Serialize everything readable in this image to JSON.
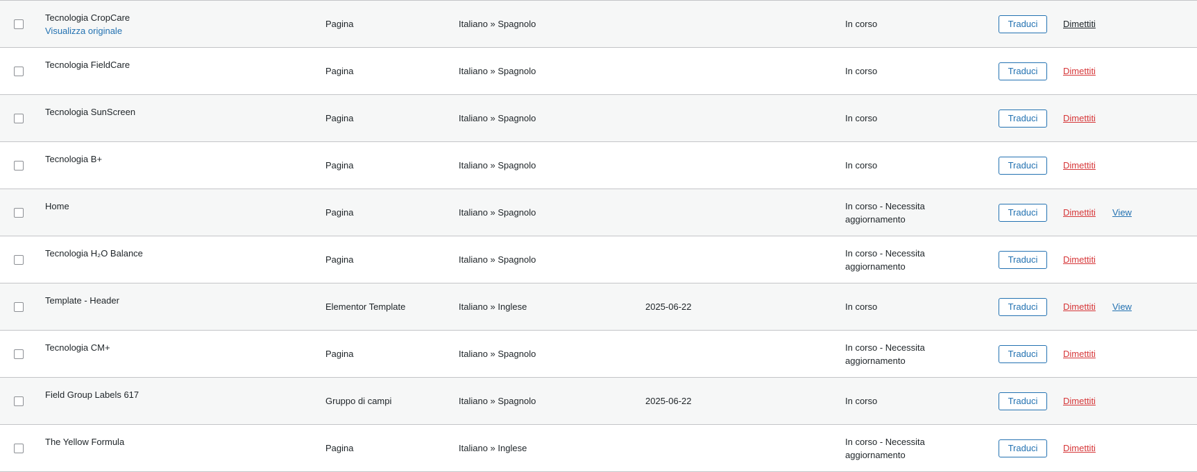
{
  "colors": {
    "link_blue": "#2271b1",
    "danger_red": "#d63638",
    "text": "#1d2327",
    "row_alt": "#f6f7f7",
    "border": "#c3c4c7"
  },
  "rows": [
    {
      "title": "Tecnologia CropCare",
      "subtitle": "Visualizza originale",
      "type": "Pagina",
      "languages": "Italiano » Spagnolo",
      "date": "",
      "status": "In corso",
      "translate": "Traduci",
      "resign": "Dimettiti",
      "resign_style": "dark",
      "view": ""
    },
    {
      "title": "Tecnologia FieldCare",
      "subtitle": "",
      "type": "Pagina",
      "languages": "Italiano » Spagnolo",
      "date": "",
      "status": "In corso",
      "translate": "Traduci",
      "resign": "Dimettiti",
      "resign_style": "red",
      "view": ""
    },
    {
      "title": "Tecnologia SunScreen",
      "subtitle": "",
      "type": "Pagina",
      "languages": "Italiano » Spagnolo",
      "date": "",
      "status": "In corso",
      "translate": "Traduci",
      "resign": "Dimettiti",
      "resign_style": "red",
      "view": ""
    },
    {
      "title": "Tecnologia B+",
      "subtitle": "",
      "type": "Pagina",
      "languages": "Italiano » Spagnolo",
      "date": "",
      "status": "In corso",
      "translate": "Traduci",
      "resign": "Dimettiti",
      "resign_style": "red",
      "view": ""
    },
    {
      "title": "Home",
      "subtitle": "",
      "type": "Pagina",
      "languages": "Italiano » Spagnolo",
      "date": "",
      "status": "In corso - Necessita aggiornamento",
      "translate": "Traduci",
      "resign": "Dimettiti",
      "resign_style": "red",
      "view": "View"
    },
    {
      "title": "Tecnologia H₂O Balance",
      "subtitle": "",
      "type": "Pagina",
      "languages": "Italiano » Spagnolo",
      "date": "",
      "status": "In corso - Necessita aggiornamento",
      "translate": "Traduci",
      "resign": "Dimettiti",
      "resign_style": "red",
      "view": ""
    },
    {
      "title": "Template - Header",
      "subtitle": "",
      "type": "Elementor Template",
      "languages": "Italiano » Inglese",
      "date": "2025-06-22",
      "status": "In corso",
      "translate": "Traduci",
      "resign": "Dimettiti",
      "resign_style": "red",
      "view": "View"
    },
    {
      "title": "Tecnologia CM+",
      "subtitle": "",
      "type": "Pagina",
      "languages": "Italiano » Spagnolo",
      "date": "",
      "status": "In corso - Necessita aggiornamento",
      "translate": "Traduci",
      "resign": "Dimettiti",
      "resign_style": "red",
      "view": ""
    },
    {
      "title": "Field Group Labels 617",
      "subtitle": "",
      "type": "Gruppo di campi",
      "languages": "Italiano » Spagnolo",
      "date": "2025-06-22",
      "status": "In corso",
      "translate": "Traduci",
      "resign": "Dimettiti",
      "resign_style": "red",
      "view": ""
    },
    {
      "title": "The Yellow Formula",
      "subtitle": "",
      "type": "Pagina",
      "languages": "Italiano » Inglese",
      "date": "",
      "status": "In corso - Necessita aggiornamento",
      "translate": "Traduci",
      "resign": "Dimettiti",
      "resign_style": "red",
      "view": ""
    }
  ]
}
